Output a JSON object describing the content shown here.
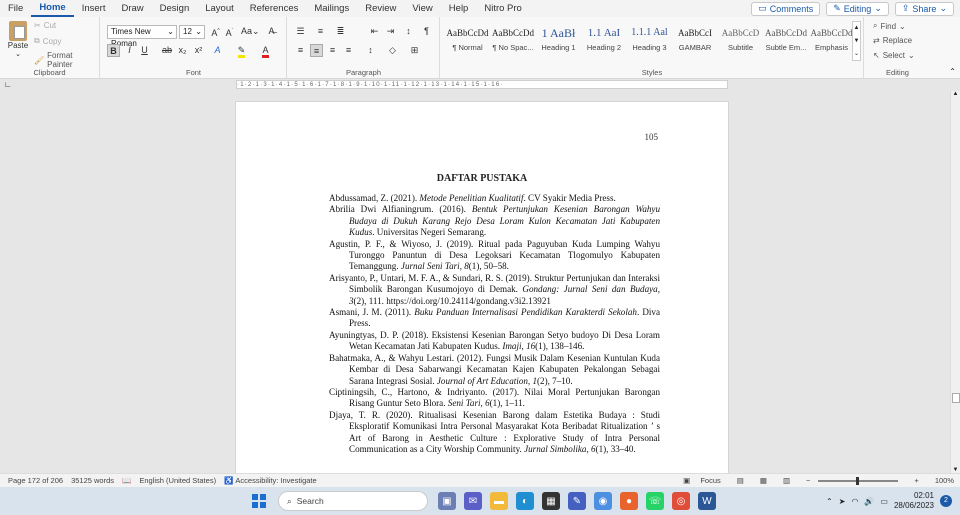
{
  "menu": {
    "tabs": [
      "File",
      "Home",
      "Insert",
      "Draw",
      "Design",
      "Layout",
      "References",
      "Mailings",
      "Review",
      "View",
      "Help",
      "Nitro Pro"
    ],
    "active": "Home",
    "comments_label": "Comments",
    "editing_label": "Editing",
    "share_label": "Share"
  },
  "clipboard": {
    "paste": "Paste",
    "cut": "Cut",
    "copy": "Copy",
    "format_painter": "Format Painter",
    "label": "Clipboard"
  },
  "font": {
    "family": "Times New Roman",
    "size": "12",
    "label": "Font",
    "bold": "B",
    "italic": "I",
    "underline": "U",
    "strike": "ab",
    "subscript": "x₂",
    "superscript": "x²"
  },
  "paragraph": {
    "label": "Paragraph"
  },
  "styles": {
    "label": "Styles",
    "items": [
      {
        "preview": "AaBbCcDd",
        "name": "¶ Normal"
      },
      {
        "preview": "AaBbCcDd",
        "name": "¶ No Spac..."
      },
      {
        "preview": "1  AaBł",
        "name": "Heading 1"
      },
      {
        "preview": "1.1  AaI",
        "name": "Heading 2"
      },
      {
        "preview": "1.1.1  Aal",
        "name": "Heading 3"
      },
      {
        "preview": "AaBbCcI",
        "name": "GAMBAR"
      },
      {
        "preview": "AaBbCcD",
        "name": "Subtitle"
      },
      {
        "preview": "AaBbCcDd",
        "name": "Subtle Em..."
      },
      {
        "preview": "AaBbCcDd",
        "name": "Emphasis"
      }
    ]
  },
  "editing": {
    "find": "Find",
    "replace": "Replace",
    "select": "Select",
    "label": "Editing"
  },
  "document": {
    "page_number": "105",
    "title": "DAFTAR PUSTAKA",
    "references_html": [
      "Abdussamad, Z. (2021). <i>Metode Penelitian Kualitatif</i>. CV Syakir Media Press.",
      "Abrilia Dwi Alfianingrum. (2016). <i>Bentuk Pertunjukan Kesenian Barongan Wahyu Budaya di Dukuh Karang Rejo Desa Loram Kulon Kecamatan Jati Kabupaten Kudus</i>. Universitas Negeri Semarang.",
      "Agustin, P. F., &amp; Wiyoso, J. (2019). Ritual pada Paguyuban Kuda Lumping Wahyu Turonggo Panuntun di Desa Legoksari Kecamatan Tlogomulyo Kabupaten Temanggung. <i>Jurnal Seni Tari</i>, <i>8</i>(1), 50–58.",
      "Arisyanto, P., Untari, M. F. A., &amp; Sundari, R. S. (2019). Struktur Pertunjukan dan Interaksi Simbolik Barongan Kusumojoyo di Demak. <i>Gondang: Jurnal Seni dan Budaya</i>, <i>3</i>(2), 111. https://doi.org/10.24114/gondang.v3i2.13921",
      "Asmani, J. M. (2011). <i>Buku Panduan Internalisasi Pendidikan Karakterdi Sekolah</i>. Diva Press.",
      "Ayuningtyas, D. P. (2018). Eksistensi Kesenian Barongan Setyo budoyo Di Desa Loram Wetan Kecamatan Jati Kabupaten Kudus. <i>Imaji</i>, <i>16</i>(1), 138–146.",
      "Bahatmaka, A., &amp; Wahyu Lestari. (2012). Fungsi Musik Dalam Kesenian Kuntulan Kuda Kembar di Desa Sabarwangi Kecamatan Kajen Kabupaten Pekalongan Sebagai Sarana Integrasi Sosial. <i>Journal of Art Education</i>, <i>1</i>(2), 7–10.",
      "Ciptiningsih, C., Hartono, &amp; Indriyanto. (2017). Nilai Moral Pertunjukan Barongan Risang Guntur Seto Blora. <i>Seni Tari</i>, <i>6</i>(1), 1–11.",
      "Djaya, T. R. (2020). Ritualisasi Kesenian Barong dalam Estetika Budaya : Studi Eksploratif Komunikasi Intra Personal Masyarakat Kota Beribadat Ritualization ’ s Art of Barong in Aesthetic Culture : Explorative Study of Intra Personal Communication as a City Worship Community. <i>Jurnal Simbolika</i>, <i>6</i>(1), 33–40."
    ]
  },
  "status": {
    "page": "Page 172 of 206",
    "words": "35125 words",
    "language": "English (United States)",
    "accessibility": "Accessibility: Investigate",
    "focus": "Focus",
    "zoom": "100%"
  },
  "taskbar": {
    "search_placeholder": "Search",
    "time": "02:01",
    "date": "28/06/2023",
    "notifications": "2"
  }
}
